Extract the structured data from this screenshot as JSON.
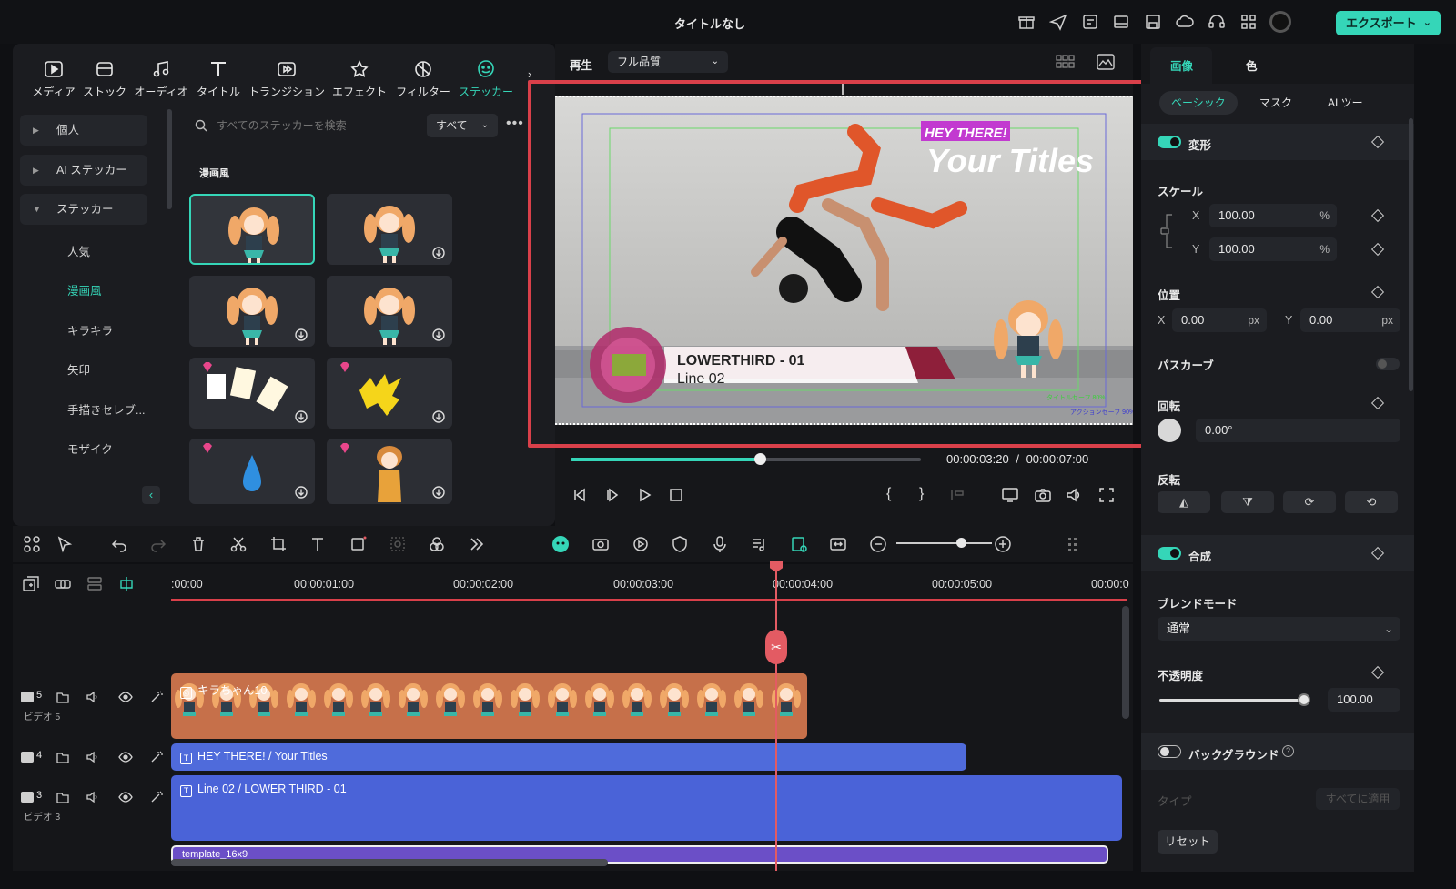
{
  "window": {
    "title": "タイトルなし",
    "export_label": "エクスポート"
  },
  "media_tabs": [
    {
      "label": "メディア",
      "icon": "media-icon"
    },
    {
      "label": "ストック",
      "icon": "stock-icon"
    },
    {
      "label": "オーディオ",
      "icon": "music-icon"
    },
    {
      "label": "タイトル",
      "icon": "title-icon"
    },
    {
      "label": "トランジション",
      "icon": "transition-icon"
    },
    {
      "label": "エフェクト",
      "icon": "effect-icon"
    },
    {
      "label": "フィルター",
      "icon": "filter-icon"
    },
    {
      "label": "ステッカー",
      "icon": "sticker-icon",
      "active": true
    }
  ],
  "categories": {
    "top": [
      "個人",
      "AI ステッカー",
      "ステッカー"
    ],
    "sub": [
      "人気",
      "漫画風",
      "キラキラ",
      "矢印",
      "手描きセレブ...",
      "モザイク"
    ],
    "active_sub": "漫画風"
  },
  "search": {
    "placeholder": "すべてのステッカーを検索",
    "filter": "すべて"
  },
  "section_label": "漫画風",
  "preview": {
    "play_label": "再生",
    "quality": "フル品質",
    "overlay_small": "HEY THERE!",
    "overlay_big": "Your Titles",
    "lower_third_1": "LOWERTHIRD - 01",
    "lower_third_2": "Line 02",
    "safe_title": "タイトルセーフ 80%",
    "safe_action": "アクションセーフ 90%",
    "progress": 0.54,
    "time_current": "00:00:03:20",
    "time_sep": "/",
    "time_total": "00:00:07:00"
  },
  "right_panel": {
    "tabs": [
      "画像",
      "色"
    ],
    "subtabs": [
      "ベーシック",
      "マスク",
      "AI ツー"
    ],
    "transform_label": "変形",
    "scale_label": "スケール",
    "scale_x": "100.00",
    "scale_y": "100.00",
    "pct": "%",
    "x_label": "X",
    "y_label": "Y",
    "position_label": "位置",
    "pos_x": "0.00",
    "pos_y": "0.00",
    "px": "px",
    "path_curve_label": "パスカーブ",
    "rotation_label": "回転",
    "rotation_value": "0.00°",
    "flip_label": "反転",
    "composite_label": "合成",
    "blend_label": "ブレンドモード",
    "blend_value": "通常",
    "opacity_label": "不透明度",
    "opacity_value": "100.00",
    "background_label": "バックグラウンド",
    "type_label": "タイプ",
    "apply_all": "すべてに適用",
    "reset_label": "リセット"
  },
  "timeline": {
    "ticks": [
      ":00:00",
      "00:00:01:00",
      "00:00:02:00",
      "00:00:03:00",
      "00:00:04:00",
      "00:00:05:00",
      "00:00:0"
    ],
    "tracks": [
      {
        "num": "5",
        "name": "ビデオ 5"
      },
      {
        "num": "4",
        "name": ""
      },
      {
        "num": "3",
        "name": "ビデオ 3"
      }
    ],
    "clips": {
      "sticker": "キラちゃん10",
      "title1": "HEY THERE! / Your Titles",
      "title2": "Line 02 / LOWER THIRD - 01",
      "template": "template_16x9"
    }
  },
  "colors": {
    "accent": "#35d6b8",
    "highlight": "#d9404a",
    "sticker_clip": "#c6704a",
    "title_clip": "#4f6bdb"
  }
}
